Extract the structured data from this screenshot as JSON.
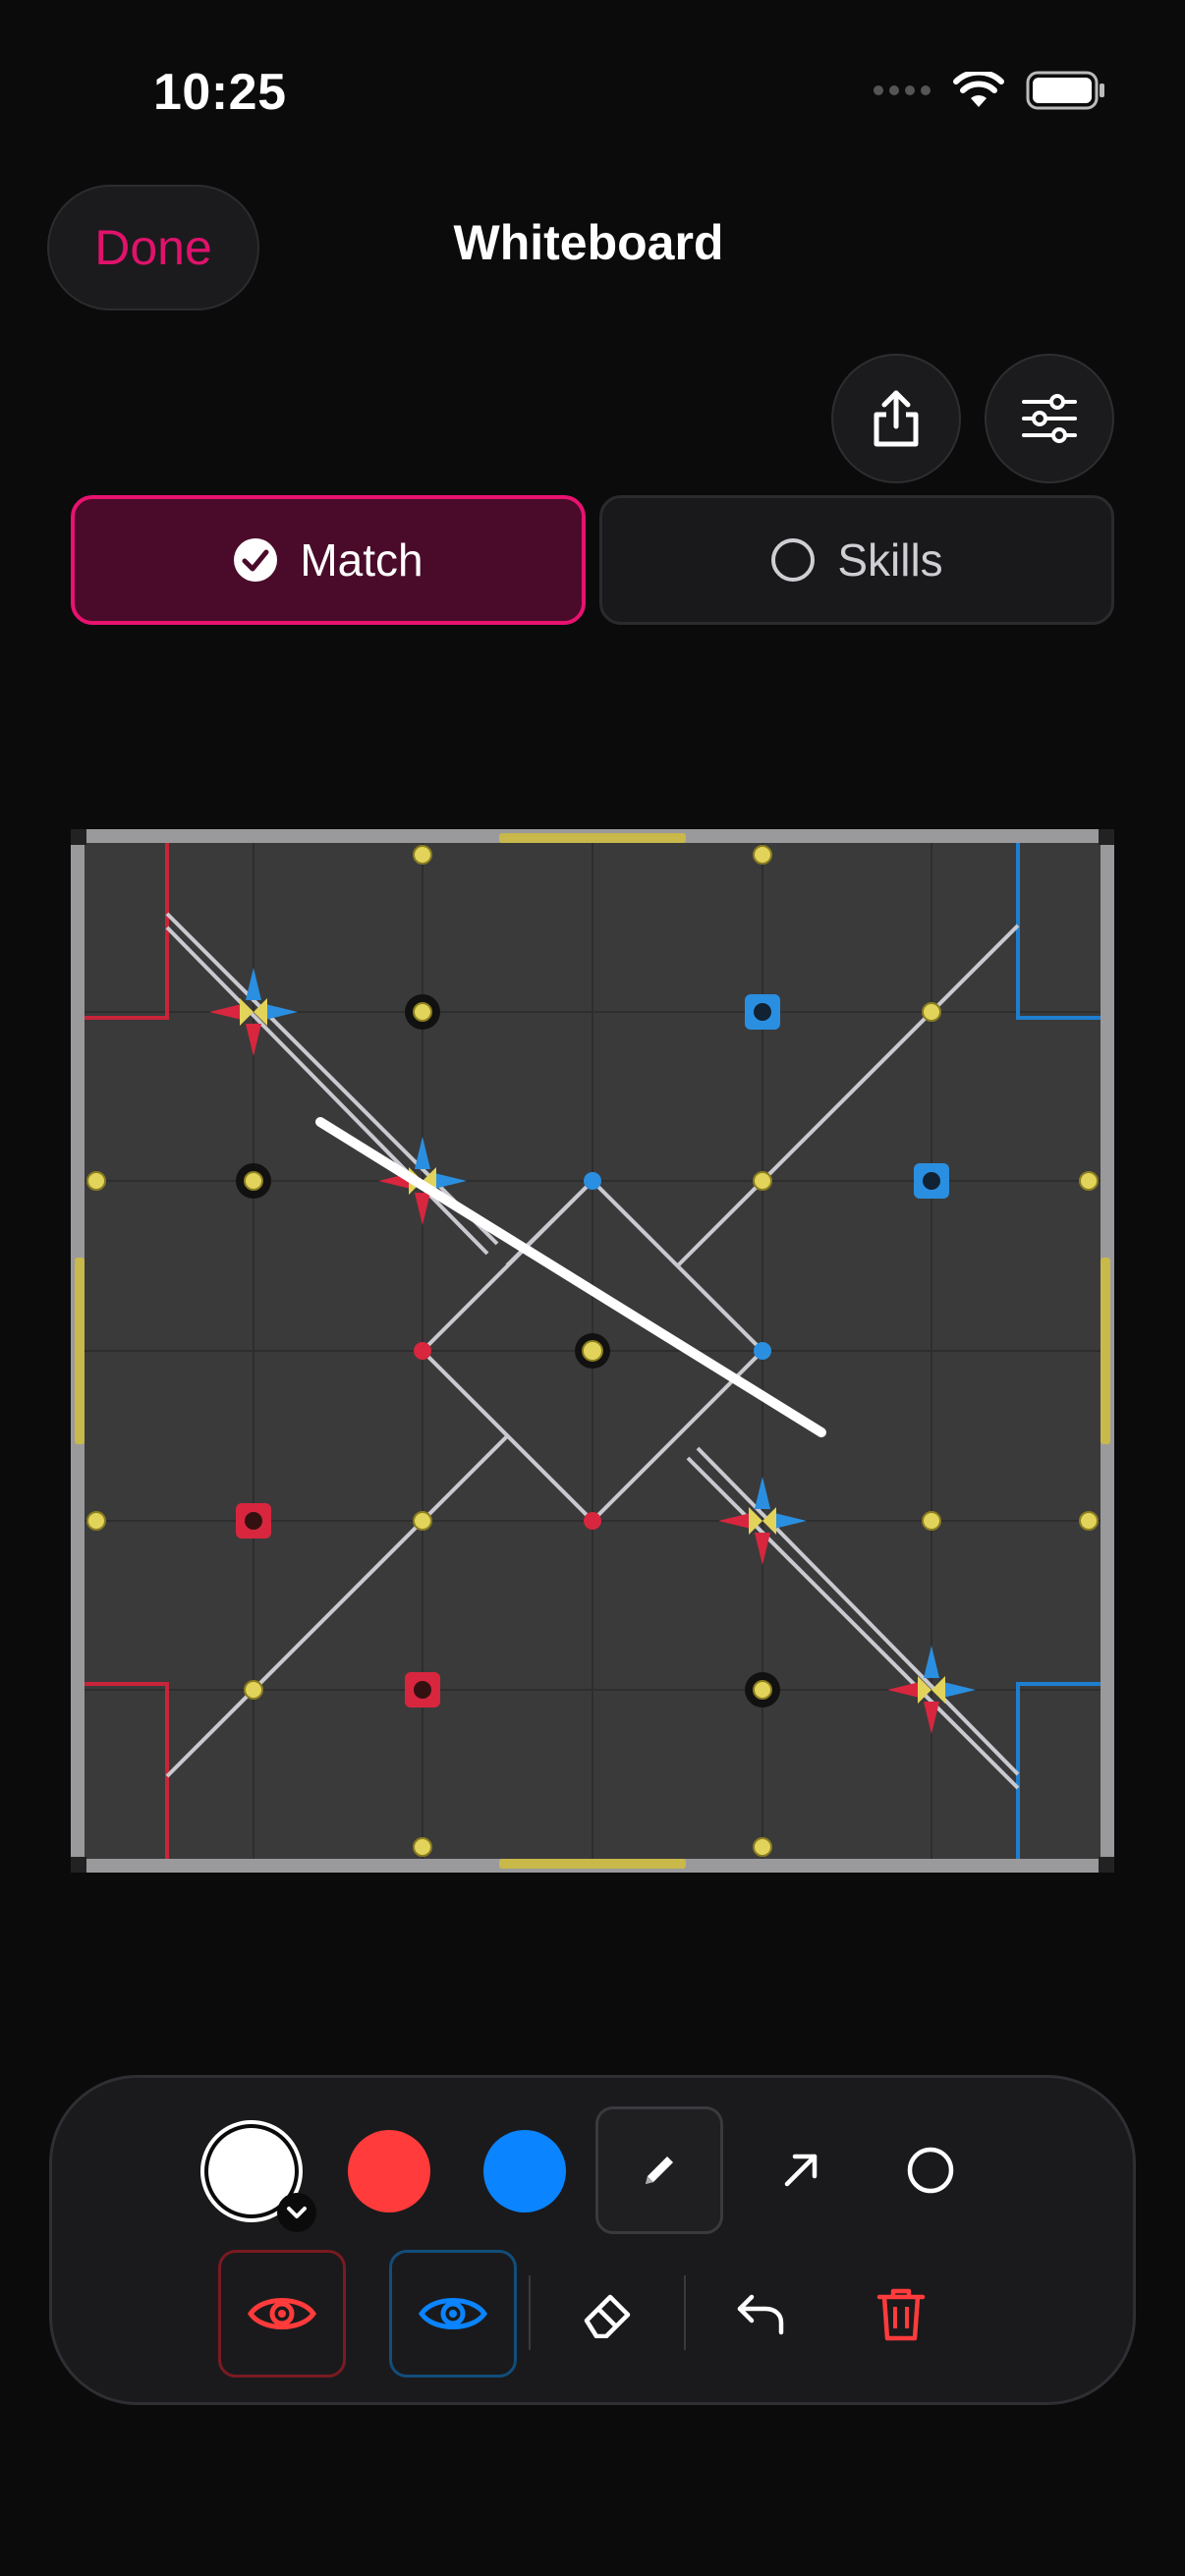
{
  "status": {
    "time": "10:25"
  },
  "header": {
    "done_label": "Done",
    "title": "Whiteboard"
  },
  "mode_tabs": [
    {
      "label": "Match",
      "selected": true
    },
    {
      "label": "Skills",
      "selected": false
    }
  ],
  "colors": {
    "accent": "#E8126F",
    "red": "#FF3B3B",
    "blue": "#0A84FF",
    "white": "#FFFFFF",
    "background": "#0B0B0C"
  },
  "toolbar": {
    "pen_colors": [
      "white",
      "red",
      "blue"
    ],
    "selected_color": "white",
    "tools": [
      "pencil-icon",
      "arrow-icon",
      "circle-icon"
    ],
    "selected_tool": "pencil",
    "actions": [
      "red-eye-icon",
      "blue-eye-icon",
      "eraser-icon",
      "undo-icon",
      "trash-icon"
    ]
  }
}
